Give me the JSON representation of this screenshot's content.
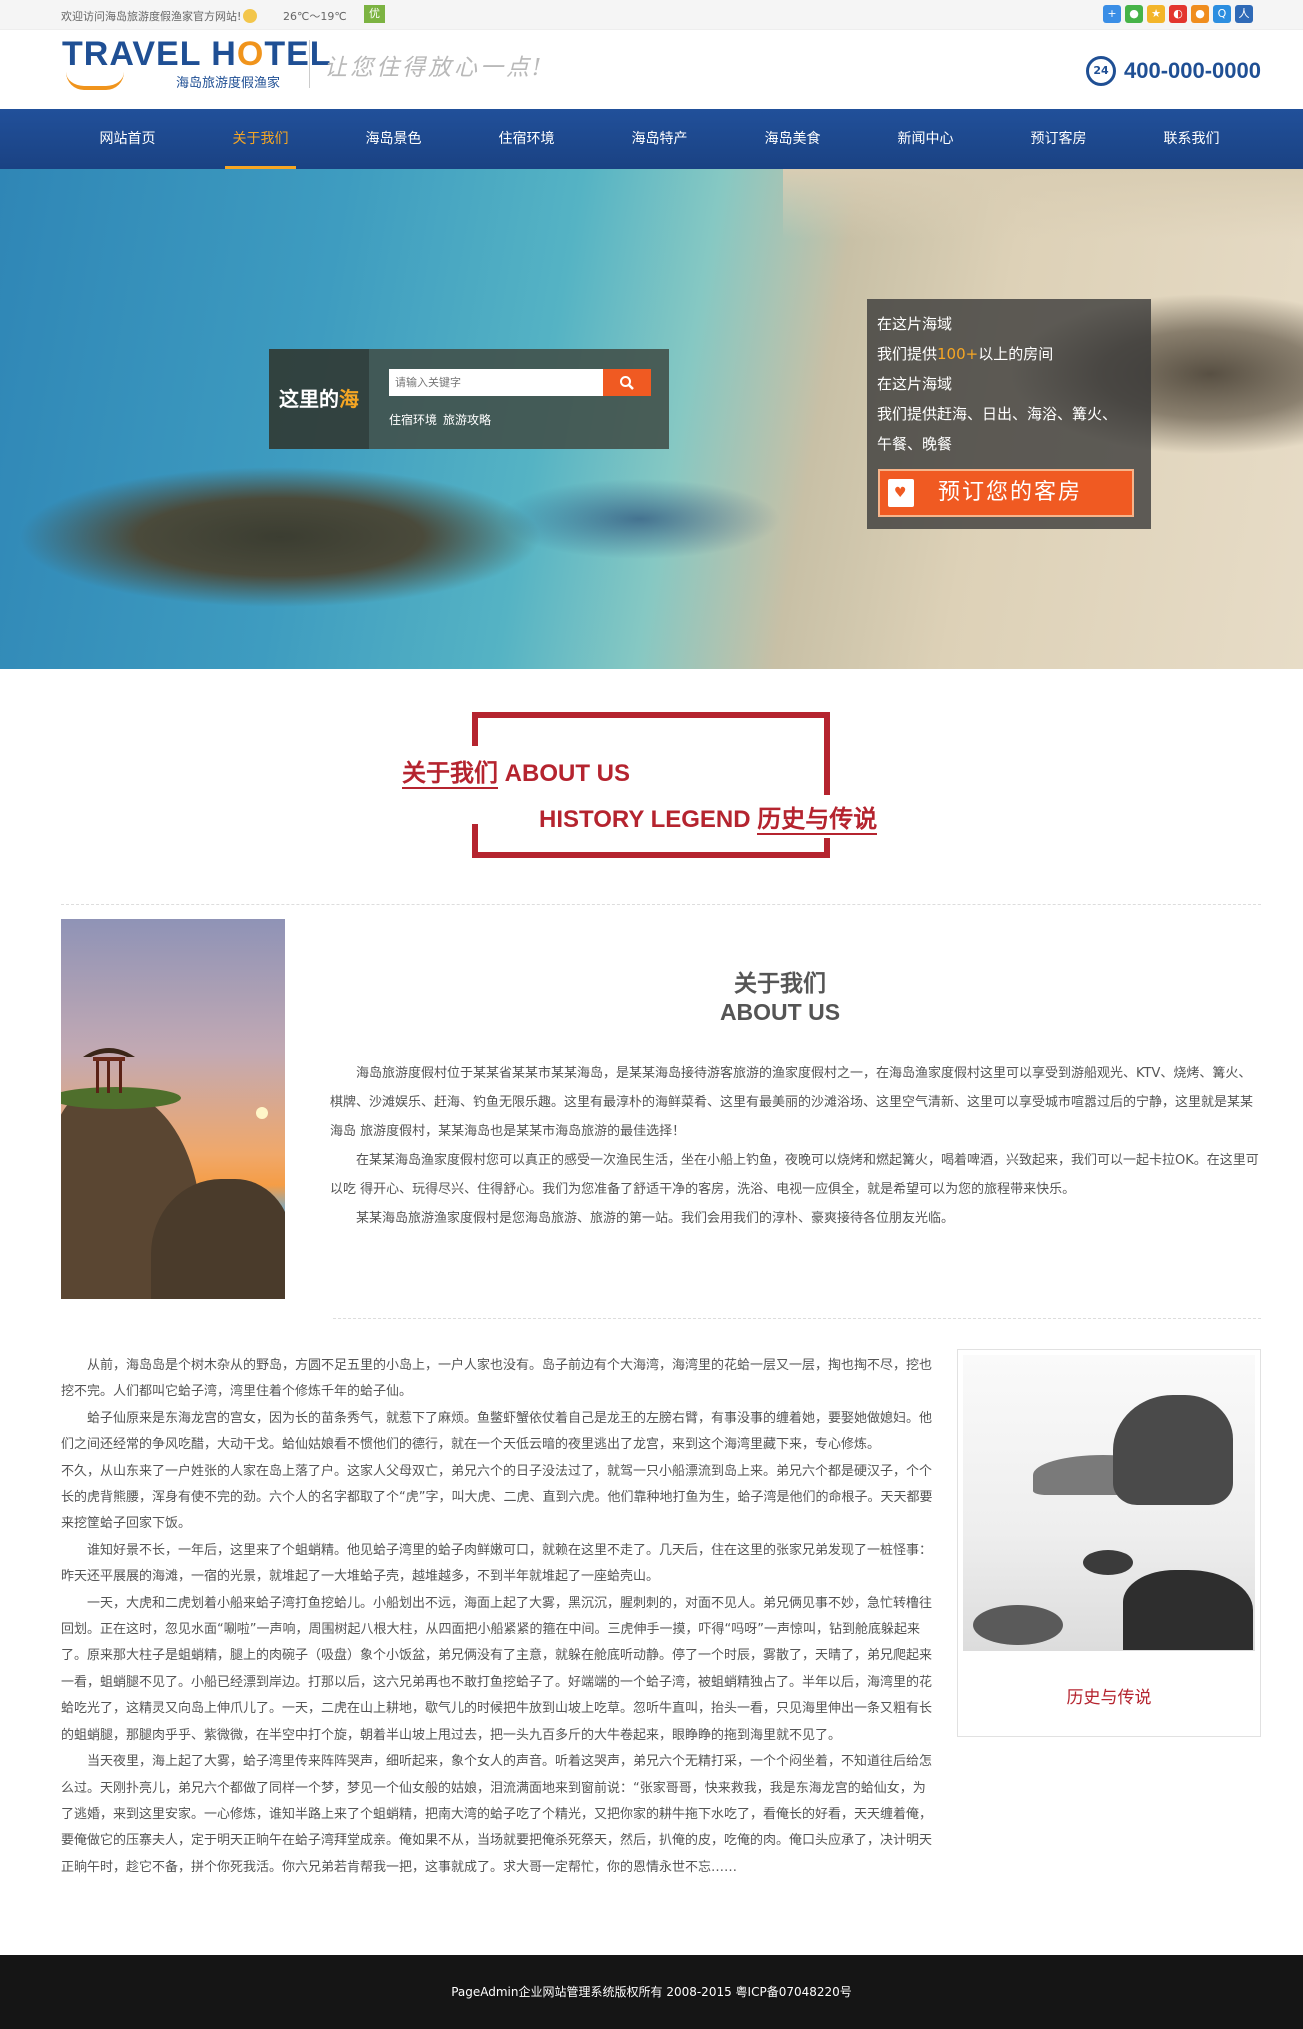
{
  "topbar": {
    "welcome": "欢迎访问海岛旅游度假渔家官方网站!",
    "weather": "26℃～19℃",
    "air_quality": "优",
    "social_icons": [
      {
        "name": "add-icon",
        "glyph": "+",
        "color": "#3a8ee6"
      },
      {
        "name": "wechat-icon",
        "glyph": "●",
        "color": "#46b348"
      },
      {
        "name": "qzone-icon",
        "glyph": "★",
        "color": "#f3b52a"
      },
      {
        "name": "weibo-icon",
        "glyph": "◐",
        "color": "#e3352e"
      },
      {
        "name": "tencent-weibo-icon",
        "glyph": "●",
        "color": "#f08d1e"
      },
      {
        "name": "qq-icon",
        "glyph": "Q",
        "color": "#2c8ee0"
      },
      {
        "name": "renren-icon",
        "glyph": "人",
        "color": "#2f6ab7"
      }
    ]
  },
  "header": {
    "logo_en_pre": "TRAVEL H",
    "logo_en_o": "O",
    "logo_en_post": "TEL",
    "logo_cn": "海岛旅游度假渔家",
    "slogan": "让您住得放心一点!",
    "hotline_badge": "24",
    "hotline": "400-000-0000"
  },
  "nav": [
    {
      "label": "网站首页",
      "active": false
    },
    {
      "label": "关于我们",
      "active": true
    },
    {
      "label": "海岛景色",
      "active": false
    },
    {
      "label": "住宿环境",
      "active": false
    },
    {
      "label": "海岛特产",
      "active": false
    },
    {
      "label": "海岛美食",
      "active": false
    },
    {
      "label": "新闻中心",
      "active": false
    },
    {
      "label": "预订客房",
      "active": false
    },
    {
      "label": "联系我们",
      "active": false
    }
  ],
  "banner": {
    "search_label_pre": "这里的",
    "search_label_hl": "海",
    "search_placeholder": "请输入关键字",
    "tags": [
      "住宿环境",
      "旅游攻略"
    ],
    "promo_line1": "在这片海域",
    "promo_line2_pre": "我们提供",
    "promo_line2_hl": "100+",
    "promo_line2_post": "以上的房间",
    "promo_line3": "在这片海域",
    "promo_line4": "我们提供赶海、日出、海浴、篝火、",
    "promo_line5": "午餐、晚餐",
    "book_button": "预订您的客房"
  },
  "about_heading": {
    "line1_u": "关于我们",
    "line1_rest": " ABOUT US",
    "line2_rest": "HISTORY LEGEND ",
    "line2_u": "历史与传说"
  },
  "about": {
    "title_cn": "关于我们",
    "title_en": "ABOUT US",
    "paragraphs": [
      "海岛旅游度假村位于某某省某某市某某海岛，是某某海岛接待游客旅游的渔家度假村之一，在海岛渔家度假村这里可以享受到游船观光、KTV、烧烤、篝火、棋牌、沙滩娱乐、赶海、钓鱼无限乐趣。这里有最淳朴的海鲜菜肴、这里有最美丽的沙滩浴场、这里空气清新、这里可以享受城市喧嚣过后的宁静，这里就是某某海岛 旅游度假村，某某海岛也是某某市海岛旅游的最佳选择！",
      "在某某海岛渔家度假村您可以真正的感受一次渔民生活，坐在小船上钓鱼，夜晚可以烧烤和燃起篝火，喝着啤酒，兴致起来，我们可以一起卡拉OK。在这里可以吃 得开心、玩得尽兴、住得舒心。我们为您准备了舒适干净的客房，洗浴、电视一应俱全，就是希望可以为您的旅程带来快乐。",
      "某某海岛旅游渔家度假村是您海岛旅游、旅游的第一站。我们会用我们的淳朴、豪爽接待各位朋友光临。"
    ]
  },
  "history": {
    "paragraphs": [
      "从前，海岛岛是个树木杂从的野岛，方圆不足五里的小岛上，一户人家也没有。岛子前边有个大海湾，海湾里的花蛤一层又一层，掏也掏不尽，挖也挖不完。人们都叫它蛤子湾，湾里住着个修炼千年的蛤子仙。",
      "蛤子仙原来是东海龙宫的宫女，因为长的苗条秀气，就惹下了麻烦。鱼鳖虾蟹依仗着自己是龙王的左膀右臂，有事没事的缠着她，要娶她做媳妇。他们之间还经常的争风吃醋，大动干戈。蛤仙姑娘看不惯他们的德行，就在一个天低云暗的夜里逃出了龙宫，来到这个海湾里藏下来，专心修炼。",
      "不久，从山东来了一户姓张的人家在岛上落了户。这家人父母双亡，弟兄六个的日子没法过了，就驾一只小船漂流到岛上来。弟兄六个都是硬汉子，个个长的虎背熊腰，浑身有使不完的劲。六个人的名字都取了个“虎”字，叫大虎、二虎、直到六虎。他们靠种地打鱼为生，蛤子湾是他们的命根子。天天都要来挖筐蛤子回家下饭。",
      "谁知好景不长，一年后，这里来了个蛆蛸精。他见蛤子湾里的蛤子肉鲜嫩可口，就赖在这里不走了。几天后，住在这里的张家兄弟发现了一桩怪事：昨天还平展展的海滩，一宿的光景，就堆起了一大堆蛤子壳，越堆越多，不到半年就堆起了一座蛤壳山。",
      "一天，大虎和二虎划着小船来蛤子湾打鱼挖蛤儿。小船划出不远，海面上起了大雾，黑沉沉，腥刺刺的，对面不见人。弟兄俩见事不妙，急忙转橹往回划。正在这时，忽见水面“唰啦”一声响，周围树起八根大柱，从四面把小船紧紧的箍在中间。三虎伸手一摸，吓得“吗呀”一声惊叫，钻到舱底躲起来了。原来那大柱子是蛆蛸精，腿上的肉碗子（吸盘）象个小饭盆，弟兄俩没有了主意，就躲在舱底听动静。停了一个时辰，雾散了，天晴了，弟兄爬起来一看，蛆蛸腿不见了。小船已经漂到岸边。打那以后，这六兄弟再也不敢打鱼挖蛤子了。好端端的一个蛤子湾，被蛆蛸精独占了。半年以后，海湾里的花蛤吃光了，这精灵又向岛上伸爪儿了。一天，二虎在山上耕地，歇气儿的时候把牛放到山坡上吃草。忽听牛直叫，抬头一看，只见海里伸出一条又粗有长的蛆蛸腿，那腿肉乎乎、紫微微，在半空中打个旋，朝着半山坡上甩过去，把一头九百多斤的大牛卷起来，眼睁睁的拖到海里就不见了。",
      "当天夜里，海上起了大雾，蛤子湾里传来阵阵哭声，细听起来，象个女人的声音。听着这哭声，弟兄六个无精打采，一个个闷坐着，不知道往后给怎么过。天刚扑亮儿，弟兄六个都做了同样一个梦，梦见一个仙女般的姑娘，泪流满面地来到窗前说：“张家哥哥，快来救我，我是东海龙宫的蛤仙女，为了逃婚，来到这里安家。一心修炼，谁知半路上来了个蛆蛸精，把南大湾的蛤子吃了个精光，又把你家的耕牛拖下水吃了，看俺长的好看，天天缠着俺，要俺做它的压寨夫人，定于明天正晌午在蛤子湾拜堂成亲。俺如果不从，当场就要把俺杀死祭天，然后，扒俺的皮，吃俺的肉。俺口头应承了，决计明天正晌午时，趁它不备，拼个你死我活。你六兄弟若肯帮我一把，这事就成了。求大哥一定帮忙，你的恩情永世不忘……"
    ],
    "card_caption": "历史与传说"
  },
  "footer": {
    "copyright": "PageAdmin企业网站管理系统版权所有 2008-2015 粤ICP备07048220号"
  }
}
